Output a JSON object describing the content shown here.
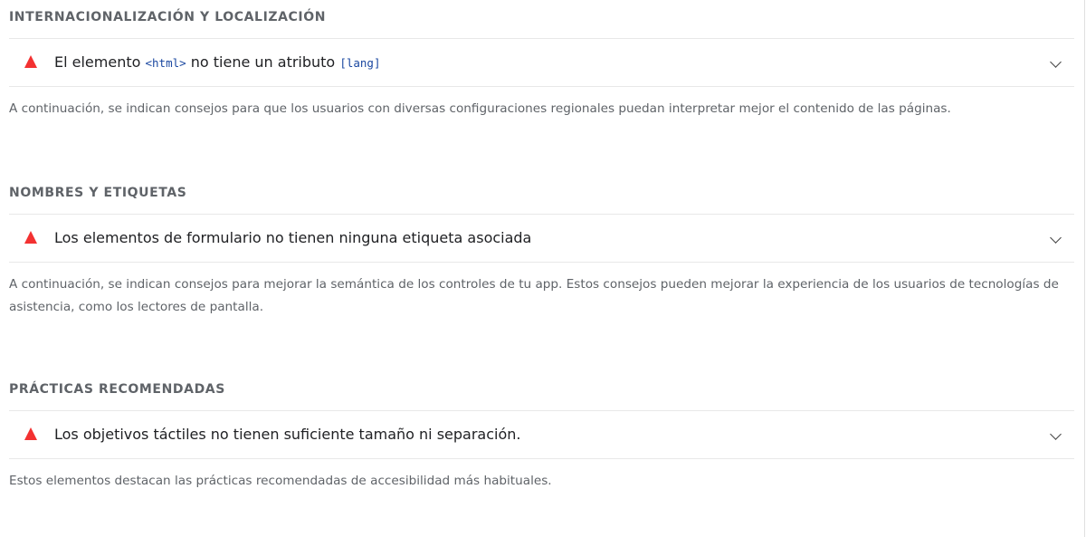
{
  "groups": [
    {
      "title": "INTERNACIONALIZACIÓN Y LOCALIZACIÓN",
      "audit": {
        "title_before": "El elemento ",
        "code1": "<html>",
        "title_middle": " no tiene un atributo ",
        "code2": "[lang]",
        "icon": "fail-triangle-icon",
        "chevron": "chevron-down-icon"
      },
      "description": "A continuación, se indican consejos para que los usuarios con diversas configuraciones regionales puedan interpretar mejor el contenido de las páginas."
    },
    {
      "title": "NOMBRES Y ETIQUETAS",
      "audit": {
        "title": "Los elementos de formulario no tienen ninguna etiqueta asociada",
        "icon": "fail-triangle-icon",
        "chevron": "chevron-down-icon"
      },
      "description": "A continuación, se indican consejos para mejorar la semántica de los controles de tu app. Estos consejos pueden mejorar la experiencia de los usuarios de tecnologías de asistencia, como los lectores de pantalla."
    },
    {
      "title": "PRÁCTICAS RECOMENDADAS",
      "audit": {
        "title": "Los objetivos táctiles no tienen suficiente tamaño ni separación.",
        "icon": "fail-triangle-icon",
        "chevron": "chevron-down-icon"
      },
      "description": "Estos elementos destacan las prácticas recomendadas de accesibilidad más habituales."
    }
  ],
  "colors": {
    "fail": "#f33131",
    "code": "#1a47a0",
    "muted": "#5f6368"
  }
}
